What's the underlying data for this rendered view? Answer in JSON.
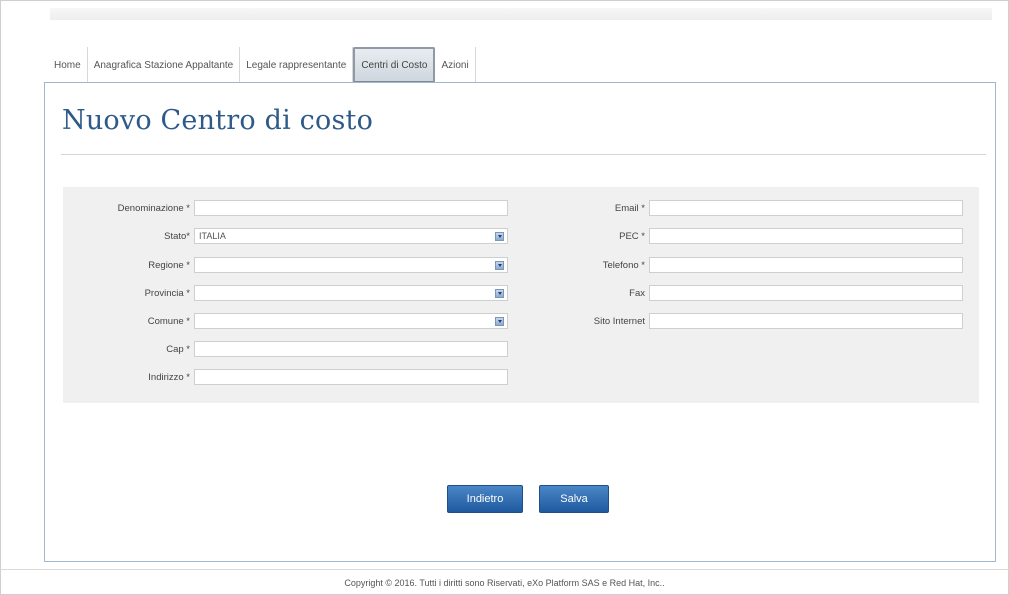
{
  "tabs": [
    {
      "label": "Home",
      "active": false
    },
    {
      "label": "Anagrafica Stazione Appaltante",
      "active": false
    },
    {
      "label": "Legale rappresentante",
      "active": false
    },
    {
      "label": "Centri di Costo",
      "active": true
    },
    {
      "label": "Azioni",
      "active": false
    }
  ],
  "page": {
    "title": "Nuovo Centro di costo"
  },
  "form": {
    "left": {
      "denominazione": {
        "label": "Denominazione *",
        "value": ""
      },
      "stato": {
        "label": "Stato*",
        "value": "ITALIA"
      },
      "regione": {
        "label": "Regione *",
        "value": ""
      },
      "provincia": {
        "label": "Provincia *",
        "value": ""
      },
      "comune": {
        "label": "Comune *",
        "value": ""
      },
      "cap": {
        "label": "Cap *",
        "value": ""
      },
      "indirizzo": {
        "label": "Indirizzo *",
        "value": ""
      }
    },
    "right": {
      "email": {
        "label": "Email *",
        "value": ""
      },
      "pec": {
        "label": "PEC *",
        "value": ""
      },
      "telefono": {
        "label": "Telefono *",
        "value": ""
      },
      "fax": {
        "label": "Fax",
        "value": ""
      },
      "sito": {
        "label": "Sito Internet",
        "value": ""
      }
    }
  },
  "buttons": {
    "back": "Indietro",
    "save": "Salva"
  },
  "footer": {
    "text": "Copyright © 2016. Tutti i diritti sono Riservati, eXo Platform SAS e Red Hat, Inc.."
  },
  "colors": {
    "title": "#2e5a8a",
    "button": "#2a66ad",
    "panel_border": "#9fb8cf"
  }
}
